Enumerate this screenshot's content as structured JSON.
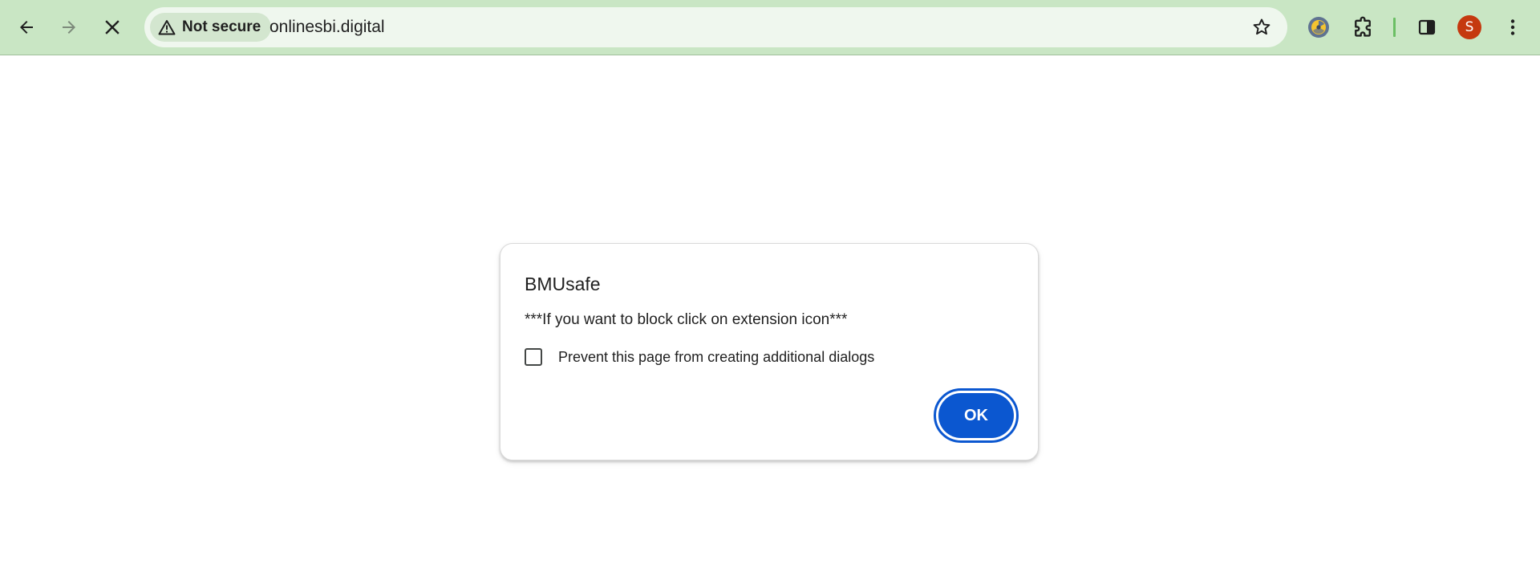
{
  "browser": {
    "security_chip_label": "Not secure",
    "url": "onlinesbi.digital",
    "profile_initial": "S",
    "accent_color": "#c9e6c4",
    "profile_color": "#c5390f",
    "icons": {
      "back": "arrow-left-icon",
      "forward": "arrow-right-icon",
      "stop": "close-icon",
      "security": "warning-triangle-icon",
      "bookmark": "star-outline-icon",
      "extension_active": "extension-badge-icon",
      "extensions": "puzzle-piece-icon",
      "side_panel": "side-panel-icon",
      "menu": "kebab-menu-icon"
    }
  },
  "dialog": {
    "title": "BMUsafe",
    "message": "***If you want to block click on extension icon***",
    "checkbox_label": "Prevent this page from creating additional dialogs",
    "checkbox_checked": false,
    "ok_label": "OK",
    "button_color": "#0b57d0"
  }
}
